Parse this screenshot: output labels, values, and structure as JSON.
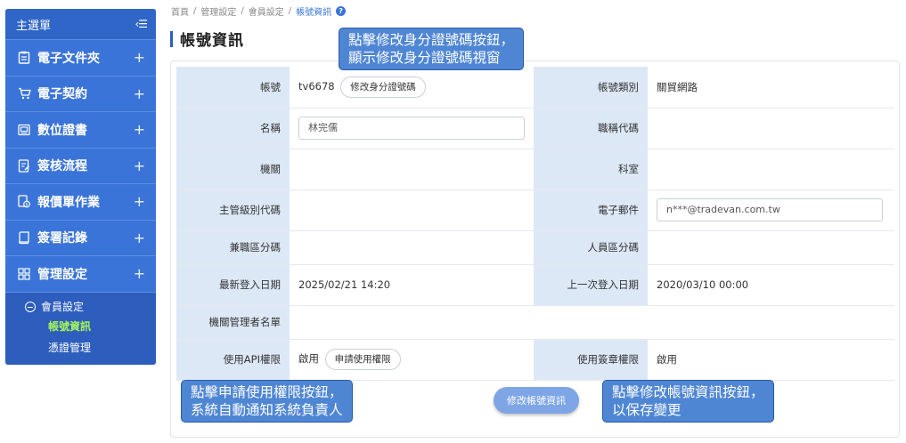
{
  "sidebar": {
    "title": "主選單",
    "toggle": "‹☰",
    "items": [
      {
        "label": "電子文件夾",
        "icon": "clipboard-icon"
      },
      {
        "label": "電子契約",
        "icon": "cart-icon"
      },
      {
        "label": "數位證書",
        "icon": "certificate-icon"
      },
      {
        "label": "簽核流程",
        "icon": "document-edit-icon"
      },
      {
        "label": "報價單作業",
        "icon": "quote-dollar-icon"
      },
      {
        "label": "簽署記錄",
        "icon": "book-icon"
      },
      {
        "label": "管理設定",
        "icon": "grid-icon"
      }
    ],
    "plus": "+",
    "sub_parent": "會員設定",
    "sub_children": [
      {
        "label": "帳號資訊",
        "active": true
      },
      {
        "label": "憑證管理",
        "active": false
      }
    ]
  },
  "breadcrumb": {
    "items": [
      "首頁",
      "管理設定",
      "會員設定"
    ],
    "current": "帳號資訊",
    "sep": "/",
    "help": "?"
  },
  "page_title": "帳號資訊",
  "form": {
    "account_label": "帳號",
    "account_value": "tv6678",
    "change_id_button": "修改身分證號碼",
    "account_type_label": "帳號類別",
    "account_type_value": "關貿網路",
    "name_label": "名稱",
    "name_value": "林完儒",
    "job_title_code_label": "職稱代碼",
    "job_title_code_value": "",
    "org_label": "機關",
    "org_value": "",
    "section_label": "科室",
    "section_value": "",
    "supervisor_code_label": "主管級別代碼",
    "supervisor_code_value": "",
    "email_label": "電子郵件",
    "email_value": "n***@tradevan.com.tw",
    "concurrent_code_label": "兼職區分碼",
    "concurrent_code_value": "",
    "staff_code_label": "人員區分碼",
    "staff_code_value": "",
    "last_login_label": "最新登入日期",
    "last_login_value": "2025/02/21 14:20",
    "prev_login_label": "上一次登入日期",
    "prev_login_value": "2020/03/10 00:00",
    "admin_list_label": "機關管理者名單",
    "admin_list_value": "",
    "api_label": "使用API權限",
    "api_value": "啟用",
    "apply_button": "申請使用權限",
    "sign_label": "使用簽章權限",
    "sign_value": "啟用"
  },
  "save_button": "修改帳號資訊",
  "callouts": {
    "top": [
      "點擊修改身分證號碼按鈕，",
      "顯示修改身分證號碼視窗"
    ],
    "bottom_left": [
      "點擊申請使用權限按鈕，",
      "系統自動通知系統負責人"
    ],
    "bottom_right": [
      "點擊修改帳號資訊按鈕，",
      "以保存變更"
    ]
  },
  "colors": {
    "sidebar": "#3a74d8",
    "label_bg": "#dde8f7",
    "callout": "#4f86d4",
    "active_sub": "#a6f45a"
  }
}
